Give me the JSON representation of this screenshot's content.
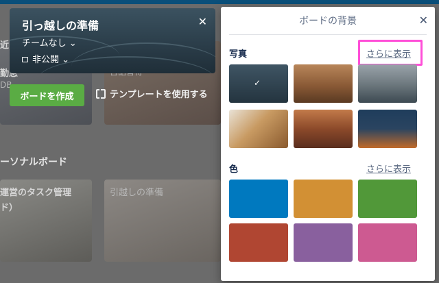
{
  "background": {
    "card_texts": [
      "近",
      "勤怠",
      "DB",
      "言語習得"
    ],
    "section_heading": "ーソナルボード",
    "boards": [
      "運営のタスク管理",
      "ド）",
      "引越しの準備"
    ]
  },
  "create_card": {
    "title": "引っ越しの準備",
    "close_symbol": "✕",
    "team": "チームなし ⌄",
    "visibility": "非公開 ⌄",
    "create_button": "ボードを作成",
    "template_link": "テンプレートを使用する"
  },
  "popover": {
    "title": "ボードの背景",
    "close_symbol": "✕",
    "photos_label": "写真",
    "photos_more": "さらに表示",
    "colors_label": "色",
    "colors_more": "さらに表示",
    "selected_mark": "✓",
    "photos": [
      "dark-sea",
      "desert-canyon",
      "alpine-village",
      "wood-lattice",
      "autumn-forest",
      "lake-night"
    ],
    "colors": [
      "#0079bf",
      "#d29034",
      "#519839",
      "#b04632",
      "#89609e",
      "#cd5a91"
    ],
    "highlight_color": "#ff4fd8"
  }
}
